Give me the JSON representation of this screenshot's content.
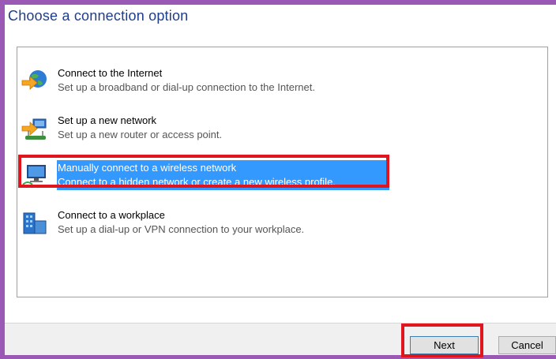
{
  "dialog": {
    "title": "Choose a connection option"
  },
  "options": [
    {
      "title": "Connect to the Internet",
      "description": "Set up a broadband or dial-up connection to the Internet.",
      "icon": "globe-internet-icon",
      "selected": false
    },
    {
      "title": "Set up a new network",
      "description": "Set up a new router or access point.",
      "icon": "router-network-icon",
      "selected": false
    },
    {
      "title": "Manually connect to a wireless network",
      "description": "Connect to a hidden network or create a new wireless profile.",
      "icon": "wireless-monitor-icon",
      "selected": true
    },
    {
      "title": "Connect to a workplace",
      "description": "Set up a dial-up or VPN connection to your workplace.",
      "icon": "workplace-building-icon",
      "selected": false
    }
  ],
  "buttons": {
    "next": "Next",
    "cancel": "Cancel"
  },
  "colors": {
    "title_text": "#1f3d8a",
    "selection": "#3399ff",
    "annotation_red": "#e0151d",
    "window_border": "#9b59b6"
  }
}
